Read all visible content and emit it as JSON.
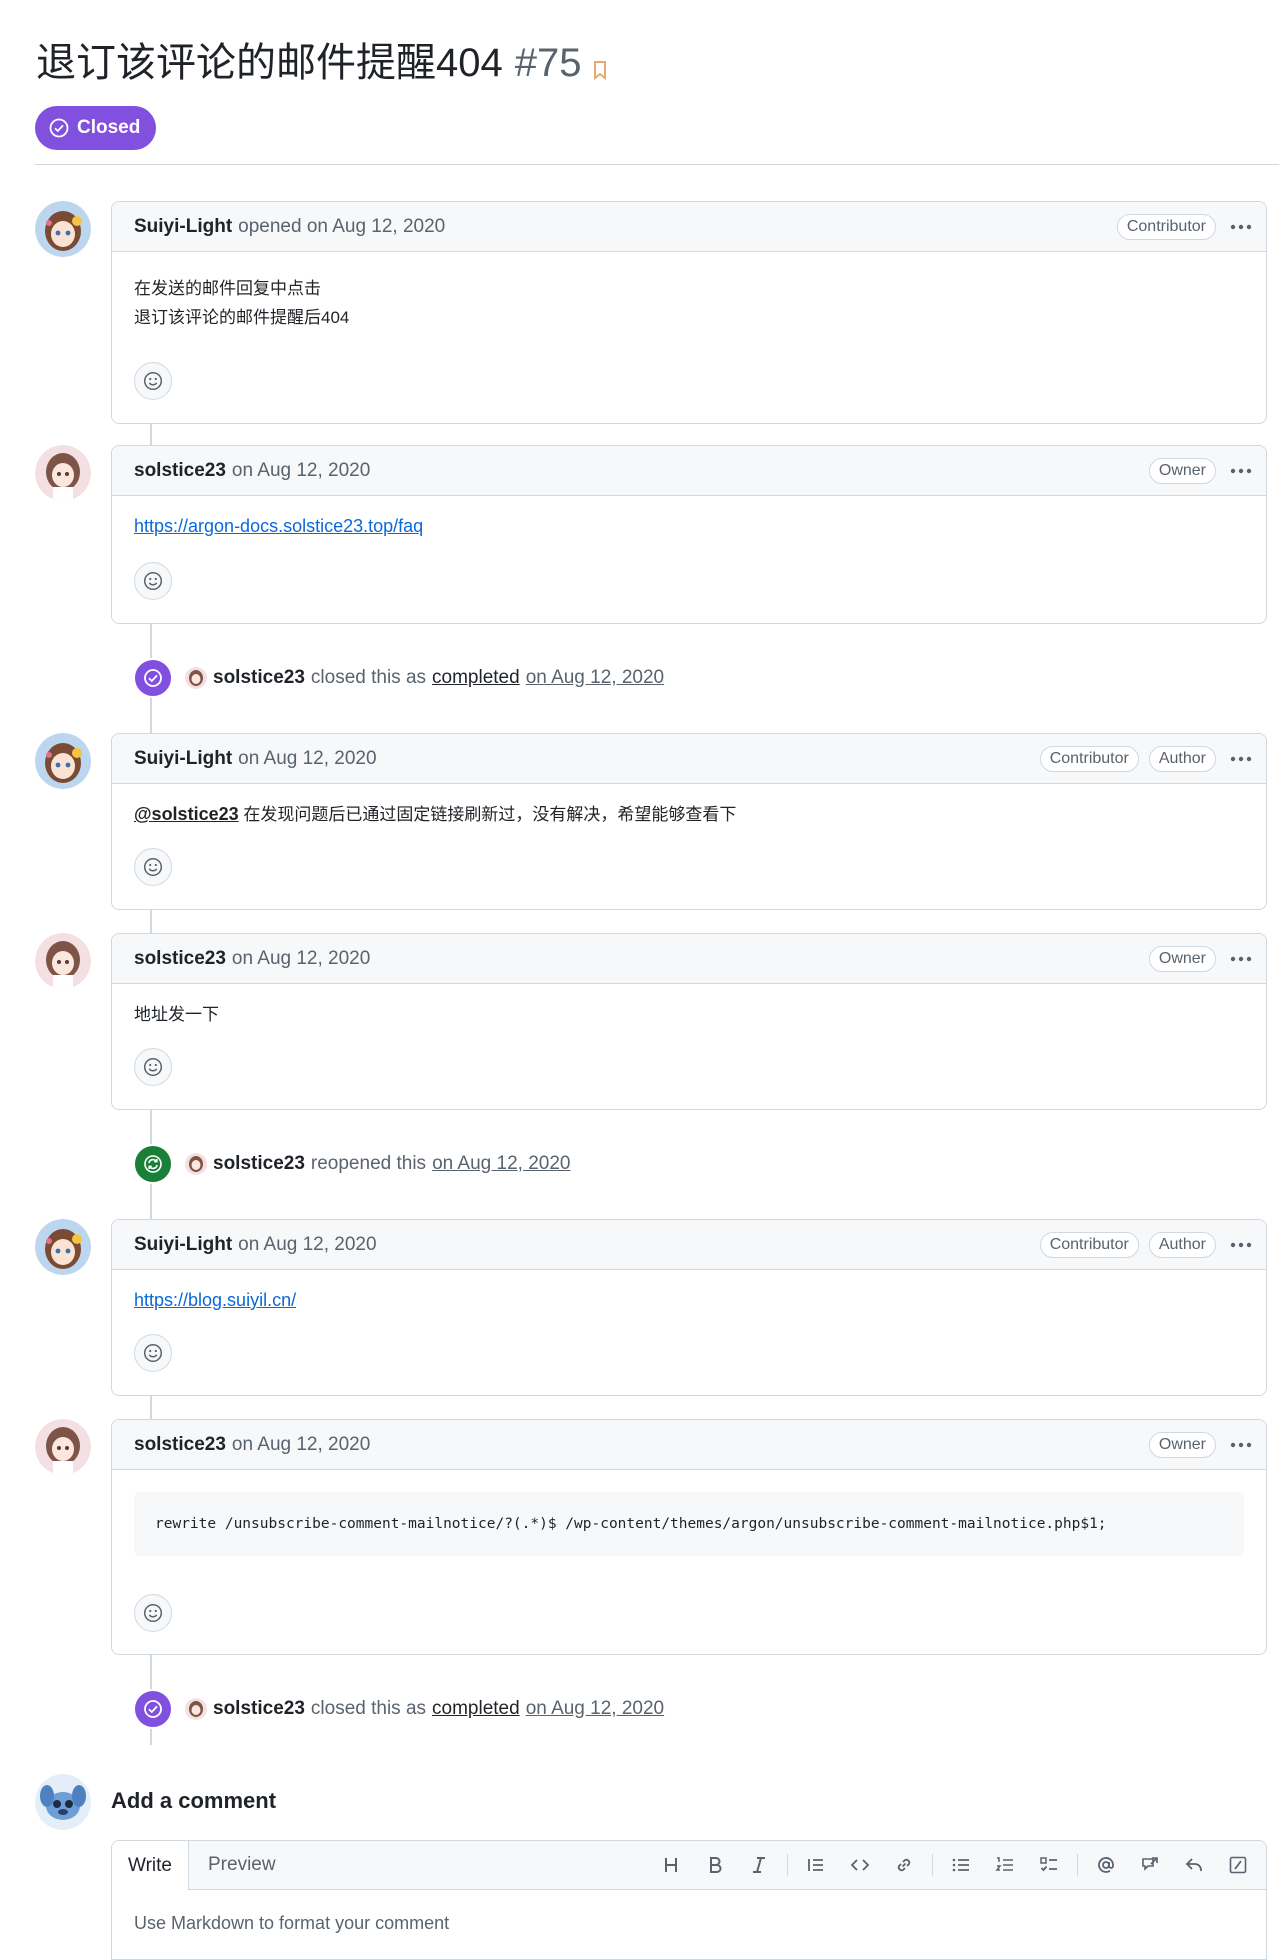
{
  "issue": {
    "title": "退订该评论的邮件提醒404",
    "number": "#75",
    "status": "Closed"
  },
  "comments": [
    {
      "author": "Suiyi-Light",
      "meta": "opened on Aug 12, 2020",
      "badges": [
        "Contributor"
      ],
      "body_lines": [
        "在发送的邮件回复中点击",
        "退订该评论的邮件提醒后404"
      ]
    },
    {
      "author": "solstice23",
      "meta": "on Aug 12, 2020",
      "badges": [
        "Owner"
      ],
      "link": "https://argon-docs.solstice23.top/faq"
    },
    {
      "author": "Suiyi-Light",
      "meta": "on Aug 12, 2020",
      "badges": [
        "Contributor",
        "Author"
      ],
      "mention": "@solstice23",
      "text": "在发现问题后已通过固定链接刷新过，没有解决，希望能够查看下"
    },
    {
      "author": "solstice23",
      "meta": "on Aug 12, 2020",
      "badges": [
        "Owner"
      ],
      "text": "地址发一下"
    },
    {
      "author": "Suiyi-Light",
      "meta": "on Aug 12, 2020",
      "badges": [
        "Contributor",
        "Author"
      ],
      "link": "https://blog.suiyil.cn/"
    },
    {
      "author": "solstice23",
      "meta": "on Aug 12, 2020",
      "badges": [
        "Owner"
      ],
      "code": "rewrite /unsubscribe-comment-mailnotice/?(.*)$ /wp-content/themes/argon/unsubscribe-comment-mailnotice.php$1;"
    }
  ],
  "events": [
    {
      "actor": "solstice23",
      "action": "closed this as",
      "reason": "completed",
      "date": "on Aug 12, 2020"
    },
    {
      "actor": "solstice23",
      "action": "reopened this",
      "date": "on Aug 12, 2020"
    },
    {
      "actor": "solstice23",
      "action": "closed this as",
      "reason": "completed",
      "date": "on Aug 12, 2020"
    }
  ],
  "composer": {
    "title": "Add a comment",
    "tab_write": "Write",
    "tab_preview": "Preview",
    "placeholder": "Use Markdown to format your comment",
    "toolbar_icons": [
      "heading-icon",
      "bold-icon",
      "italic-icon",
      "quote-icon",
      "code-icon",
      "link-icon",
      "bullet-list-icon",
      "numbered-list-icon",
      "task-list-icon",
      "mention-icon",
      "reference-icon",
      "reply-icon",
      "slash-command-icon"
    ]
  },
  "colors": {
    "closed_purple": "#8250df",
    "reopened_green": "#1a7f37",
    "link_blue": "#0969da",
    "border": "#d1d9e0"
  }
}
